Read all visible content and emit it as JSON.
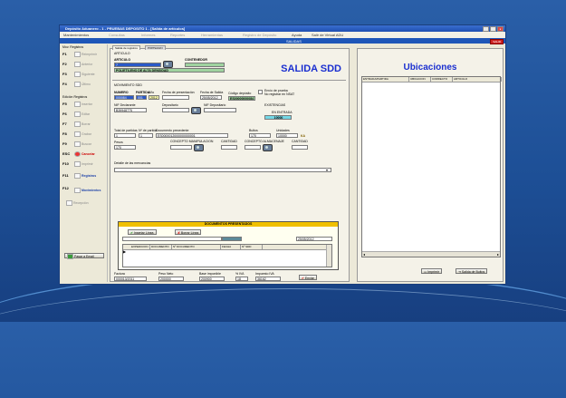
{
  "window": {
    "title": "Depósito Aduanero - 1 - PRUEBAS DEPOSITO 1 - [Salida de artículos]",
    "menu": [
      "Mantenimientos",
      "Consultas",
      "Informes",
      "Reportes",
      "Herramientas",
      "Registro de Depósito",
      "Ayuda",
      "Salir de Virtual ADU"
    ],
    "band_label": "SALIDAS",
    "salir": "SALIR"
  },
  "left_nav": {
    "header1": "Mov. Registros",
    "items_top": [
      {
        "key": "F1",
        "label": "Reimprimir"
      },
      {
        "key": "F2",
        "label": "Anterior"
      },
      {
        "key": "F3",
        "label": "Siguiente"
      },
      {
        "key": "F4",
        "label": "Último"
      }
    ],
    "header2": "Edición Registros",
    "items_bottom": [
      {
        "key": "F5",
        "label": "Insertar"
      },
      {
        "key": "F6",
        "label": "Editar"
      },
      {
        "key": "F7",
        "label": "Borrar"
      },
      {
        "key": "F8",
        "label": "Grabar"
      },
      {
        "key": "F9",
        "label": "Buscar"
      },
      {
        "key": "ESC",
        "label": "Cancelar"
      },
      {
        "key": "F10",
        "label": "Imprimir"
      },
      {
        "key": "F11",
        "label": "Registros"
      },
      {
        "key": "F12",
        "label": "Movimientos"
      },
      {
        "key": "",
        "label": "Recepción"
      }
    ],
    "email_button": "Pasar a Email"
  },
  "form": {
    "tabs": [
      "Salida de registros",
      "POPISAGIN"
    ],
    "title": "SALIDA SDD",
    "section_articulo": "ARTICULO",
    "articulo_label": "ARTICULO",
    "articulo_value": "7",
    "contenedor_label": "CONTENEDOR",
    "articulo_desc": "POLIETILENO DE ALTA DENSIDAD",
    "section_mov": "MOVIMIENTO SDD",
    "numero_label": "NUMERO",
    "numero_value": "000084",
    "partida_label": "PARTIDA",
    "partida_value": "001",
    "anyo_label": "Año",
    "anyo_value": "2012",
    "fecha_pres_label": "Fecha de presentación",
    "fecha_pres_value": "",
    "fecha_salida_label": "Fecha de Salida",
    "fecha_salida_value": "25/05/2012",
    "cod_deposito_label": "Código depósito",
    "cod_deposito_value": "ES00000000084",
    "envio_label": "Envío de prueba",
    "envio_label2": "No registrar en NSAT",
    "nif_declarante_label": "NIF Declarante",
    "nif_declarante_value": "B39948775",
    "depositario_label": "Depositario",
    "nif_depositario_label": "NIF Depositario",
    "existencias_label": "EXISTENCIAS",
    "existencias_sub": "EN ENTRADA",
    "existencias_value": "10000",
    "total_partidas_label": "Total de partidas",
    "total_partidas_value": "1",
    "n_partida_label": "Nº de partida",
    "n_partida_value": "1",
    "doc_precedente_label": "Documento precedente",
    "doc_precedente_value": "ES0000012000000000001",
    "bultos_label": "Bultos",
    "bultos_value": "170",
    "unidades_label": "Unidades",
    "unidades_value": "10000",
    "unidades_suffix": "KA",
    "pesos_label": "Pesos",
    "pesos_value": "170",
    "concepto_manip_label": "CONCEPTO MANIPULACION",
    "cantidad_label": "CANTIDAD",
    "concepto_alm_label": "CONCEPTO ALMACENAJE",
    "cantidad2_label": "CANTIDAD",
    "detalle_label": "Detalle de las mercancías",
    "docs_header": "DOCUMENTOS PRESENTADOS",
    "insert_button": "Insertar Línea",
    "delete_button": "Borrar Línea",
    "docs_date": "25/05/2012",
    "grid_cols": [
      "EXPEDICION",
      "DOCUMENTO",
      "Nº DOCUMENTO",
      "FECHA",
      "Nº SDD"
    ],
    "factura_label": "Factura",
    "factura_value": "000013/2011",
    "peso_neto_label": "Peso Neto",
    "peso_neto_value": "200000",
    "base_label": "Base imponible",
    "base_value": "200900",
    "iva_label": "% IVA",
    "iva_value": "18",
    "impuesto_label": "Impuesto IVA",
    "impuesto_value": "36162",
    "enviar_button": "Enviar"
  },
  "ubicaciones": {
    "title": "Ubicaciones",
    "cols": [
      "ENTRADA/PARTIDA",
      "UBICACION",
      "CORRECTO",
      "ARTICULO"
    ],
    "imprimir": "Imprimir",
    "salida_button": "Salida de Bultos"
  }
}
